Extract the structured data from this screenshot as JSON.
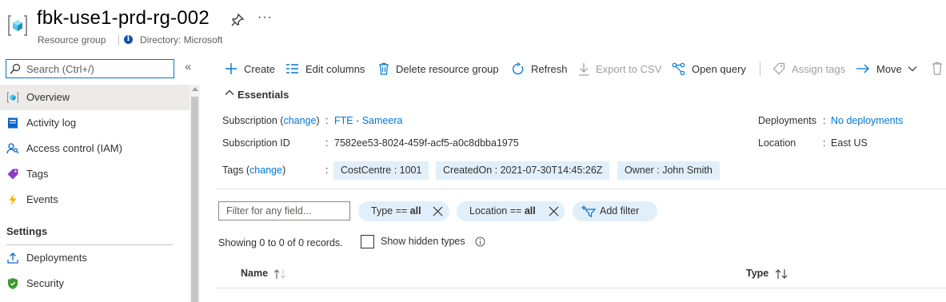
{
  "header": {
    "title": "fbk-use1-prd-rg-002",
    "subtitle": "Resource group",
    "directory": "Directory: Microsoft",
    "icons": [
      "resource-group-icon",
      "pin-icon",
      "more-icon",
      "info-icon"
    ],
    "more_label": "···"
  },
  "sidebar": {
    "search_placeholder": "Search (Ctrl+/)",
    "collapse_glyph": "«",
    "items": [
      {
        "label": "Overview",
        "icon": "overview-icon",
        "selected": true
      },
      {
        "label": "Activity log",
        "icon": "activity-log-icon"
      },
      {
        "label": "Access control (IAM)",
        "icon": "access-control-icon"
      },
      {
        "label": "Tags",
        "icon": "tag-icon"
      },
      {
        "label": "Events",
        "icon": "events-bolt-icon"
      }
    ],
    "section_settings": "Settings",
    "settings_items": [
      {
        "label": "Deployments",
        "icon": "deployments-icon"
      },
      {
        "label": "Security",
        "icon": "security-shield-icon"
      }
    ]
  },
  "commands": {
    "create": "Create",
    "edit_columns": "Edit columns",
    "delete": "Delete resource group",
    "refresh": "Refresh",
    "export": "Export to CSV",
    "open_query": "Open query",
    "assign_tags": "Assign tags",
    "move": "Move"
  },
  "essentials": {
    "title": "Essentials",
    "subscription_label": "Subscription (",
    "change": "change",
    "subscription_label_end": ")",
    "subscription_value": "FTE - Sameera",
    "subscription_id_label": "Subscription ID",
    "subscription_id_value": "7582ee53-8024-459f-acf5-a0c8dbba1975",
    "tags_label": "Tags (",
    "tags_label_end": ")",
    "colon": ":",
    "tags": [
      "CostCentre : 1001",
      "CreatedOn : 2021-07-30T14:45:26Z",
      "Owner : John Smith"
    ],
    "deployments_label": "Deployments",
    "deployments_value": "No deployments",
    "location_label": "Location",
    "location_value": "East US"
  },
  "filters": {
    "placeholder": "Filter for any field...",
    "type_pill_prefix": "Type == ",
    "type_pill_value": "all",
    "location_pill_prefix": "Location == ",
    "location_pill_value": "all",
    "add_filter": "Add filter"
  },
  "records": {
    "showing": "Showing 0 to 0 of 0 records.",
    "show_hidden": "Show hidden types"
  },
  "table": {
    "columns": [
      "Name",
      "Type"
    ]
  },
  "colors": {
    "accent": "#0078d4",
    "pill_bg": "#e1effa",
    "selected_bg": "#edebe9"
  }
}
